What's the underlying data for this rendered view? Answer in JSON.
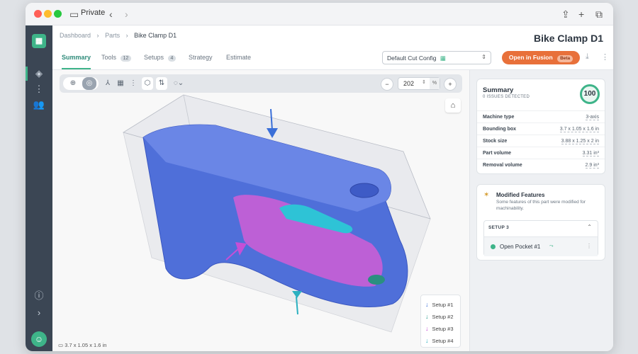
{
  "window": {
    "profile": "Private"
  },
  "breadcrumb": {
    "items": [
      "Dashboard",
      "Parts",
      "Bike Clamp D1"
    ],
    "sep": "›"
  },
  "page": {
    "title": "Bike Clamp D1"
  },
  "tabs": [
    {
      "label": "Summary",
      "badge": ""
    },
    {
      "label": "Tools",
      "badge": "12"
    },
    {
      "label": "Setups",
      "badge": "4"
    },
    {
      "label": "Strategy",
      "badge": ""
    },
    {
      "label": "Estimate",
      "badge": ""
    }
  ],
  "config": {
    "selected": "Default Cut Config"
  },
  "actions": {
    "open_label": "Open in Fusion",
    "beta_label": "Beta"
  },
  "viewport": {
    "zoom_value": "202",
    "zoom_unit": "%",
    "dimensions": "3.7 x 1.05 x 1.6 in"
  },
  "legend": {
    "items": [
      {
        "label": "Setup #1",
        "color": "#3a6fd8"
      },
      {
        "label": "Setup #2",
        "color": "#2a9d8f"
      },
      {
        "label": "Setup #3",
        "color": "#c64fd6"
      },
      {
        "label": "Setup #4",
        "color": "#2bb0c0"
      }
    ]
  },
  "summary": {
    "title": "Summary",
    "subtitle": "0 ISSUES DETECTED",
    "score": "100",
    "stats": [
      {
        "key": "Machine type",
        "value": "3-axis"
      },
      {
        "key": "Bounding box",
        "value": "3.7 x 1.05 x 1.6 in"
      },
      {
        "key": "Stock size",
        "value": "3.88 x 1.25 x 2 in"
      },
      {
        "key": "Part volume",
        "value": "3.31 in³"
      },
      {
        "key": "Removal volume",
        "value": "2.9 in³"
      }
    ]
  },
  "modified": {
    "title": "Modified Features",
    "description": "Some features of this part were modified for machinability.",
    "setup_label": "SETUP 3",
    "item_label": "Open Pocket #1"
  },
  "colors": {
    "accent": "#3eb489",
    "fusion": "#e8703a",
    "sidebar": "#3b4654",
    "part_blue": "#4f6fd9",
    "part_magenta": "#c35fd6",
    "part_cyan": "#2ec3d6"
  }
}
